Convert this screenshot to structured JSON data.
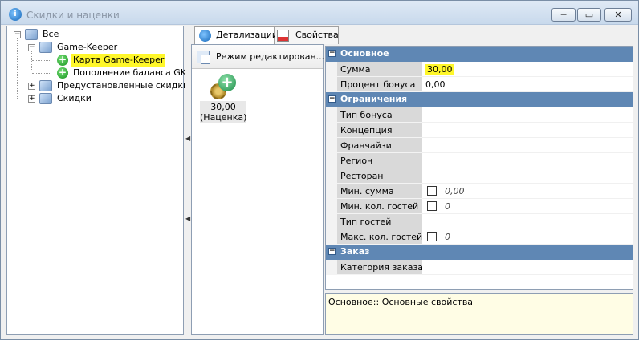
{
  "window": {
    "title": "Скидки и наценки",
    "controls": {
      "minimize": "─",
      "maximize": "▭",
      "close": "✕"
    }
  },
  "tree": {
    "root": "Все",
    "game_keeper": "Game-Keeper",
    "card_gk": "Карта Game-Keeper",
    "topup_gk": "Пополнение баланса GK",
    "preset": "Предустановленные скидки",
    "discounts": "Скидки"
  },
  "tabs": {
    "details": "Детализации",
    "properties": "Свойства"
  },
  "middle": {
    "mode": "Режим редактирован...",
    "card_value": "30,00",
    "card_type": "(Наценка)"
  },
  "grid": {
    "cat_main": "Основное",
    "cat_limits": "Ограничения",
    "cat_order": "Заказ",
    "rows": {
      "sum": {
        "name": "Сумма",
        "value": "30,00"
      },
      "bonus_pct": {
        "name": "Процент бонуса",
        "value": "0,00"
      },
      "bonus_type": {
        "name": "Тип бонуса"
      },
      "concept": {
        "name": "Концепция"
      },
      "franchise": {
        "name": "Франчайзи"
      },
      "region": {
        "name": "Регион"
      },
      "restaurant": {
        "name": "Ресторан"
      },
      "min_sum": {
        "name": "Мин. сумма",
        "value": "0,00"
      },
      "min_guests": {
        "name": "Мин. кол. гостей",
        "value": "0"
      },
      "guest_type": {
        "name": "Тип гостей"
      },
      "max_guests": {
        "name": "Макс. кол. гостей",
        "value": "0"
      },
      "order_category": {
        "name": "Категория заказа"
      }
    }
  },
  "description": "Основное:: Основные свойства"
}
